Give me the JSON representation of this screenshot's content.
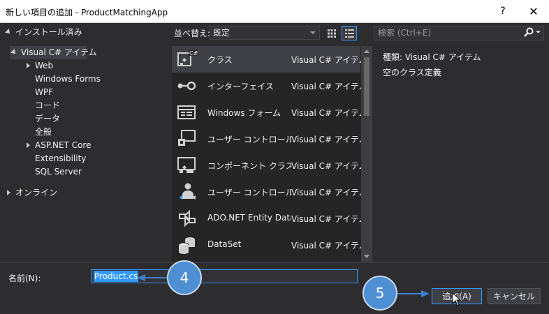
{
  "window": {
    "title": "新しい項目の追加 - ProductMatchingApp",
    "help_label": "?",
    "close_label": "✕"
  },
  "tree": {
    "installed": "インストール済み",
    "csharp": "Visual C# アイテム",
    "children": [
      "Web",
      "Windows Forms",
      "WPF",
      "コード",
      "データ",
      "全般",
      "ASP.NET Core",
      "Extensibility",
      "SQL Server"
    ],
    "online": "オンライン"
  },
  "toolbar": {
    "sort_label": "並べ替え:",
    "sort_value": "既定",
    "search_placeholder": "検索 (Ctrl+E)"
  },
  "items": [
    {
      "name": "クラス",
      "category": "Visual C# アイテム",
      "icon": "class-icon",
      "selected": true
    },
    {
      "name": "インターフェイス",
      "category": "Visual C# アイテム",
      "icon": "interface-icon"
    },
    {
      "name": "Windows フォーム",
      "category": "Visual C# アイテム",
      "icon": "windows-form-icon"
    },
    {
      "name": "ユーザー コントロール",
      "category": "Visual C# アイテム",
      "icon": "user-control-icon"
    },
    {
      "name": "コンポーネント クラス",
      "category": "Visual C# アイテム",
      "icon": "component-class-icon"
    },
    {
      "name": "ユーザー コントロール (W...",
      "category": "Visual C# アイテム",
      "icon": "wpf-user-control-icon"
    },
    {
      "name": "ADO.NET Entity Data...",
      "category": "Visual C# アイテム",
      "icon": "entity-data-icon"
    },
    {
      "name": "DataSet",
      "category": "Visual C# アイテム",
      "icon": "dataset-icon"
    }
  ],
  "details": {
    "type_line": "種類:  Visual C# アイテム",
    "description": "空のクラス定義"
  },
  "name_field": {
    "label": "名前(N):",
    "value": "Product.cs"
  },
  "buttons": {
    "add": "追加(A)",
    "cancel": "キャンセル"
  },
  "callouts": {
    "step4": "4",
    "step5": "5"
  },
  "colors": {
    "background": "#2d2d30",
    "accent": "#3399ff",
    "callout": "#4e8ed2"
  }
}
